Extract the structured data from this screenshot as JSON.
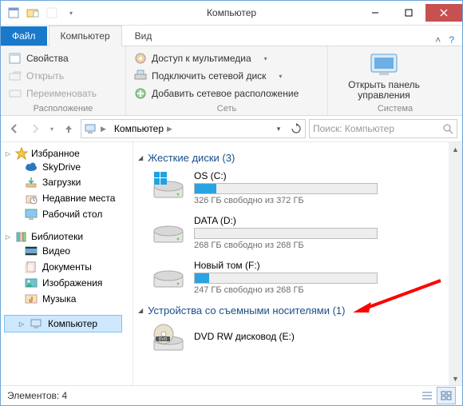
{
  "window": {
    "title": "Компьютер"
  },
  "qat_expand_tip": "▼",
  "ribbon": {
    "tabs": {
      "file": "Файл",
      "computer": "Компьютер",
      "view": "Вид"
    },
    "groups": {
      "location_label": "Расположение",
      "network_label": "Сеть",
      "system_label": "Система"
    },
    "items": {
      "properties": "Свойства",
      "open": "Открыть",
      "rename": "Переименовать",
      "media": "Доступ к мультимедиа",
      "map": "Подключить сетевой диск",
      "addnet": "Добавить сетевое расположение",
      "control_panel_l1": "Открыть панель",
      "control_panel_l2": "управления"
    }
  },
  "nav": {
    "breadcrumb": "Компьютер",
    "search_placeholder": "Поиск: Компьютер"
  },
  "sidebar": {
    "fav_title": "Избранное",
    "fav_items": [
      "SkyDrive",
      "Загрузки",
      "Недавние места",
      "Рабочий стол"
    ],
    "lib_title": "Библиотеки",
    "lib_items": [
      "Видео",
      "Документы",
      "Изображения",
      "Музыка"
    ],
    "computer": "Компьютер"
  },
  "content": {
    "hdd_section": "Жесткие диски (3)",
    "removable_section": "Устройства со съемными носителями (1)",
    "drives": [
      {
        "name": "OS (C:)",
        "sub": "326 ГБ свободно из 372 ГБ",
        "fill_pct": 12
      },
      {
        "name": "DATA (D:)",
        "sub": "268 ГБ свободно из 268 ГБ",
        "fill_pct": 0
      },
      {
        "name": "Новый том (F:)",
        "sub": "247 ГБ свободно из 268 ГБ",
        "fill_pct": 8
      }
    ],
    "dvd": "DVD RW дисковод (E:)"
  },
  "status": {
    "items": "Элементов: 4"
  }
}
